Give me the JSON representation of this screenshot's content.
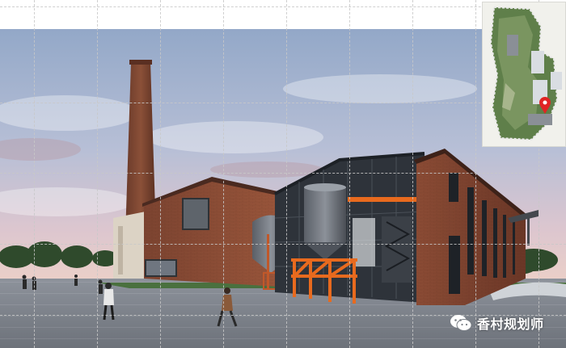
{
  "watermark": {
    "icon": "wechat-icon",
    "text": "香村规划师"
  },
  "site_map": {
    "marker_icon": "location-pin-icon",
    "marker_color": "#e02424"
  },
  "colors": {
    "sky_top": "#9fb1cc",
    "sky_horizon": "#e9c9c8",
    "brick": "#8a4a34",
    "steel": "#3a3f46",
    "orange_frame": "#e86a1e",
    "plaza": "#8f939b"
  }
}
